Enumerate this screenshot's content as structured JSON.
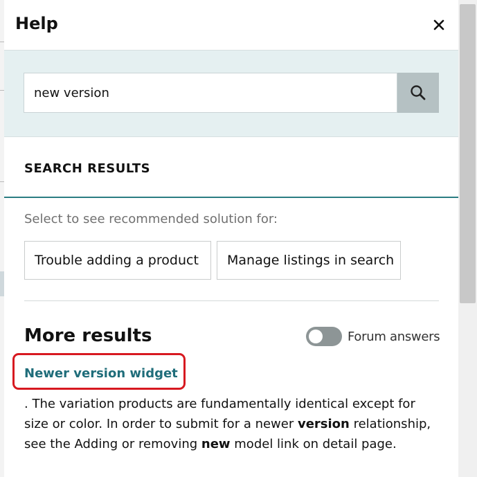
{
  "panel": {
    "title": "Help",
    "close_icon": "close-icon"
  },
  "search": {
    "value": "new version",
    "button_icon": "search-icon"
  },
  "results": {
    "heading": "SEARCH RESULTS",
    "hint": "Select to see recommended solution for:",
    "suggestions": [
      "Trouble adding a product",
      "Manage listings in search"
    ]
  },
  "more": {
    "heading": "More results",
    "toggle_label": "Forum answers",
    "toggle_on": false,
    "result_title": "Newer version widget",
    "snippet_parts": [
      ". The variation products are fundamentally identical except for size or color. In order to submit for a newer ",
      "version",
      " relationship, see the Adding or removing ",
      "new",
      " model link on detail page."
    ]
  },
  "colors": {
    "accent_teal": "#1f6d7a",
    "search_bg": "#e5f0f1",
    "highlight_red": "#d71920"
  }
}
